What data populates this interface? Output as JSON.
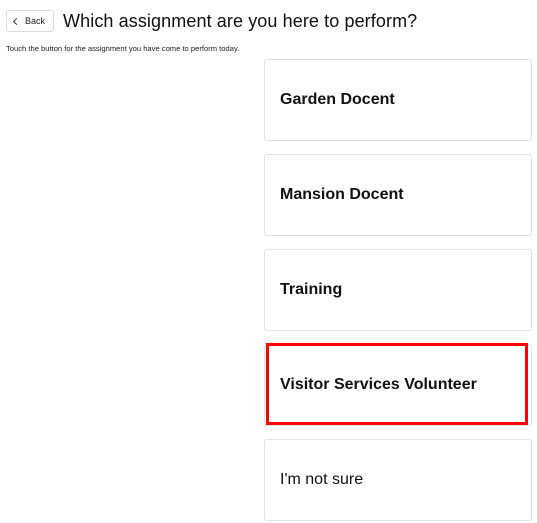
{
  "header": {
    "back_label": "Back",
    "title": "Which assignment are you here to perform?"
  },
  "instructions": "Touch the button for the assignment you have come to perform today.",
  "options": [
    {
      "label": "Garden Docent"
    },
    {
      "label": "Mansion Docent"
    },
    {
      "label": "Training"
    },
    {
      "label": "Visitor Services Volunteer",
      "highlighted": true
    },
    {
      "label": "I'm not sure"
    }
  ],
  "colors": {
    "highlight": "#ff0000",
    "card_border": "#e3e3e3",
    "text": "#111111"
  },
  "icons": {
    "back": "chevron-left-icon"
  }
}
